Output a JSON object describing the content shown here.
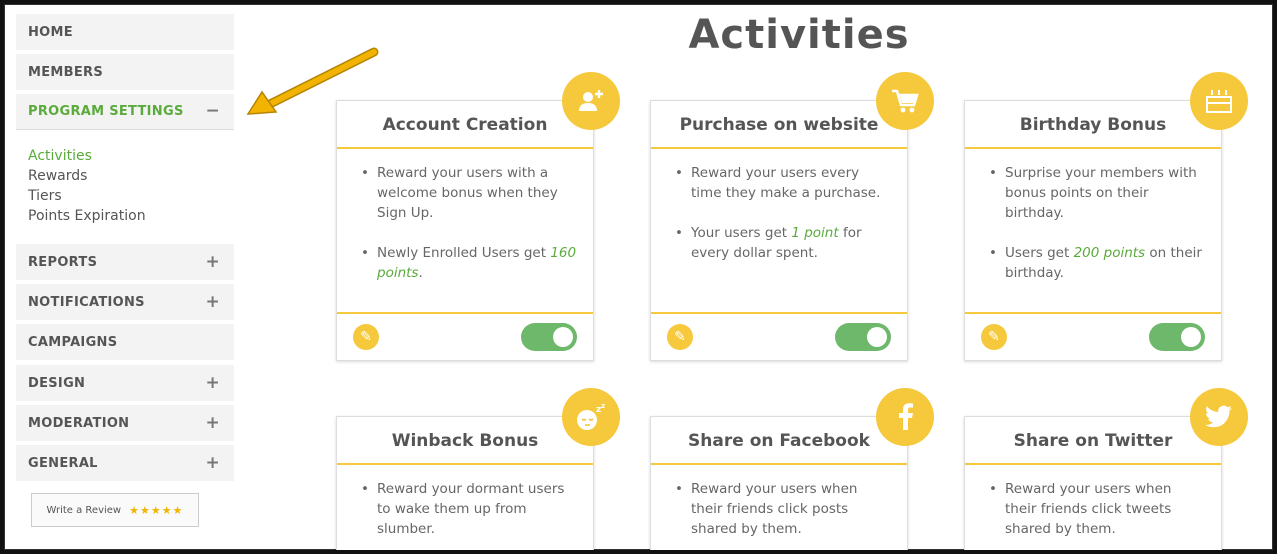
{
  "sidebar": {
    "items": [
      {
        "label": "HOME",
        "sign": ""
      },
      {
        "label": "MEMBERS",
        "sign": ""
      },
      {
        "label": "PROGRAM SETTINGS",
        "sign": "−"
      },
      {
        "label": "REPORTS",
        "sign": "+"
      },
      {
        "label": "NOTIFICATIONS",
        "sign": "+"
      },
      {
        "label": "CAMPAIGNS",
        "sign": ""
      },
      {
        "label": "DESIGN",
        "sign": "+"
      },
      {
        "label": "MODERATION",
        "sign": "+"
      },
      {
        "label": "GENERAL",
        "sign": "+"
      }
    ],
    "submenu": [
      "Activities",
      "Rewards",
      "Tiers",
      "Points Expiration"
    ],
    "review": {
      "label": "Write a Review",
      "stars": "★★★★★"
    }
  },
  "main": {
    "title": "Activities",
    "cards": [
      {
        "title": "Account Creation",
        "icon": "add-user-icon",
        "b1": "Reward your users with a welcome bonus when they Sign Up.",
        "b2_pre": "Newly Enrolled Users get ",
        "b2_hl": "160 points",
        "b2_post": ".",
        "enabled": true
      },
      {
        "title": "Purchase on website",
        "icon": "cart-icon",
        "b1": "Reward your users every time they make a purchase.",
        "b2_pre": "Your users get ",
        "b2_hl": "1 point",
        "b2_post": " for every dollar spent.",
        "enabled": true
      },
      {
        "title": "Birthday Bonus",
        "icon": "birthday-cake-icon",
        "b1": "Surprise your members with bonus points on their birthday.",
        "b2_pre": "Users get ",
        "b2_hl": "200 points",
        "b2_post": " on their birthday.",
        "enabled": true
      },
      {
        "title": "Winback Bonus",
        "icon": "sleeping-face-icon",
        "b1": "Reward your dormant users to wake them up from slumber."
      },
      {
        "title": "Share on Facebook",
        "icon": "facebook-icon",
        "b1": "Reward your users when their friends click posts shared by them."
      },
      {
        "title": "Share on Twitter",
        "icon": "twitter-icon",
        "b1": "Reward your users when their friends click tweets shared by them."
      }
    ]
  },
  "colors": {
    "accent": "#f6c83c",
    "active": "#5aab3c",
    "toggle_on": "#6db86a",
    "arrow": "#f2b400"
  }
}
